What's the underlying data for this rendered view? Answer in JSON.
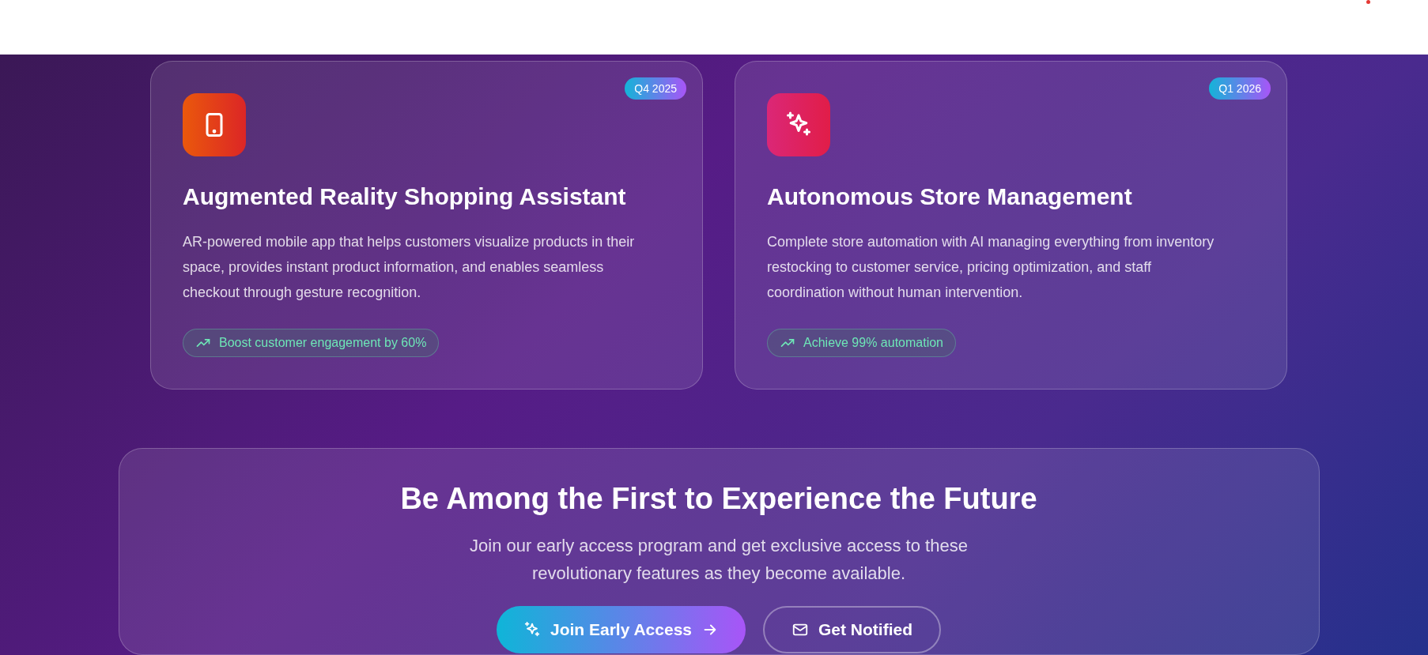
{
  "features": [
    {
      "badge": "Q4 2025",
      "title": "Augmented Reality Shopping Assistant",
      "description": "AR-powered mobile app that helps customers visualize products in their space, provides instant product information, and enables seamless checkout through gesture recognition.",
      "impact": "Boost customer engagement by 60%"
    },
    {
      "badge": "Q1 2026",
      "title": "Autonomous Store Management",
      "description": "Complete store automation with AI managing everything from inventory restocking to customer service, pricing optimization, and staff coordination without human intervention.",
      "impact": "Achieve 99% automation"
    }
  ],
  "cta": {
    "title": "Be Among the First to Experience the Future",
    "text": "Join our early access program and get exclusive access to these revolutionary features as they become available.",
    "buttons": [
      {
        "kind": "primary",
        "label": "Join Early Access"
      },
      {
        "kind": "outline",
        "label": "Get Notified"
      }
    ]
  }
}
